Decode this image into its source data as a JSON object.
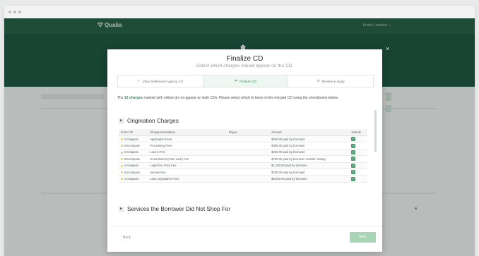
{
  "app": {
    "name": "Qualia",
    "user_menu": "Kristin Lampton ⌄"
  },
  "modal": {
    "title": "Finalize CD",
    "subtitle": "Select which charges should appear on the CD.",
    "close": "×",
    "steps": [
      {
        "icon": "✓",
        "label": "View Settlement Agency CD"
      },
      {
        "icon": "⇄",
        "label": "Finalize CD"
      },
      {
        "icon": "⊙",
        "label": "Review & Apply"
      }
    ],
    "note_count": "16 charges",
    "note_pre": "The ",
    "note_post": " marked with yellow do not appear on both CDs. Please select which to keep on the merged CD using the checkboxes below.",
    "section1": {
      "toggle": "▸",
      "title": "Origination Charges"
    },
    "section2": {
      "toggle": "▸",
      "title": "Services the Borrower Did Not Shop For"
    },
    "table": {
      "headers": [
        "From CD",
        "Charge Description",
        "Payee",
        "Amount",
        "Include"
      ],
      "rows": [
        {
          "from": "Crosspass",
          "desc": "Application Fees",
          "payee": "",
          "amount": "$316.00 paid by borrower"
        },
        {
          "from": "Encompass",
          "desc": "Processing Fees",
          "payee": "",
          "amount": "$385.00 paid by borrower"
        },
        {
          "from": "Crosspass",
          "desc": "Lock In Fee",
          "payee": "",
          "amount": "$250.00 paid by borrower"
        },
        {
          "from": "Encompass",
          "desc": "Commitment (Rate Lock) Fee",
          "payee": "",
          "amount": "$790.00 paid by borrower outside closing"
        },
        {
          "from": "Crosspass",
          "desc": "Legal Doc Prep Fee",
          "payee": "",
          "amount": "$1,160.00 paid by borrower"
        },
        {
          "from": "Encompass",
          "desc": "Service Fee",
          "payee": "",
          "amount": "$790.00 paid by borrower"
        },
        {
          "from": "Crosspass",
          "desc": "Loan Origination Fees",
          "payee": "",
          "amount": "$8,600.00 paid by borrower"
        }
      ]
    },
    "back": "Back",
    "next": "Next"
  },
  "colors": {
    "brand": "#1f5a3d",
    "accent": "#4f9e6c",
    "highlight": "#e6cf6a"
  }
}
